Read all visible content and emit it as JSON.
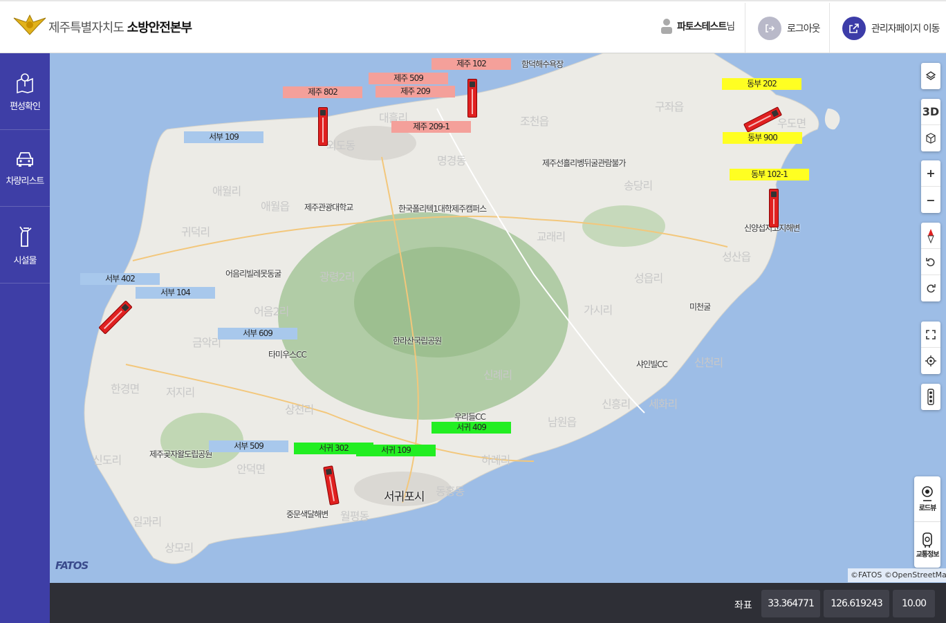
{
  "header": {
    "org_prefix": "제주특별자치도",
    "org_name": "소방안전본부",
    "user_name": "파토스테스트",
    "user_suffix": "님",
    "logout_label": "로그아웃",
    "admin_label": "관리자페이지 이동"
  },
  "sidebar": {
    "items": [
      {
        "label": "편성확인",
        "icon": "map-pin-icon"
      },
      {
        "label": "차량리스트",
        "icon": "car-icon"
      },
      {
        "label": "시설물",
        "icon": "hydrant-icon"
      }
    ]
  },
  "map": {
    "places": [
      "함덕해수욕장",
      "조천읍",
      "구좌읍",
      "우도면",
      "제주선흘리벵뒤굴관람불가",
      "송당리",
      "제주관광대학교",
      "한국폴리텍1대학제주캠퍼스",
      "애월리",
      "애월읍",
      "귀덕리",
      "교래리",
      "성산읍",
      "신양섭지코지해변",
      "미천굴",
      "어음리빌레못동굴",
      "광령2리",
      "어음2리",
      "성읍리",
      "가시리",
      "한라산국립공원",
      "금악리",
      "타미우스CC",
      "샤인빌CC",
      "신천리",
      "한경면",
      "저지리",
      "상천리",
      "신례리",
      "우리들CC",
      "남원읍",
      "신흥리",
      "세화리",
      "제주곶자왈도립공원",
      "안덕면",
      "하례리",
      "서귀포시",
      "동홍동",
      "중문색달해변",
      "월평동",
      "일과리",
      "상모리",
      "신도리",
      "대흘리",
      "명경동",
      "외도동"
    ],
    "vehicles": [
      {
        "label": "제주 102",
        "group": "jeju"
      },
      {
        "label": "제주 509",
        "group": "jeju"
      },
      {
        "label": "제주 802",
        "group": "jeju"
      },
      {
        "label": "제주 209",
        "group": "jeju"
      },
      {
        "label": "제주 209-1",
        "group": "jeju"
      },
      {
        "label": "서부 109",
        "group": "seobu"
      },
      {
        "label": "서부 402",
        "group": "seobu"
      },
      {
        "label": "서부 104",
        "group": "seobu"
      },
      {
        "label": "서부 609",
        "group": "seobu"
      },
      {
        "label": "서부 509",
        "group": "seobu"
      },
      {
        "label": "서귀 302",
        "group": "seogwi"
      },
      {
        "label": "서귀 109",
        "group": "seogwi"
      },
      {
        "label": "서귀 409",
        "group": "seogwi"
      },
      {
        "label": "동부 202",
        "group": "dongbu"
      },
      {
        "label": "동부 900",
        "group": "dongbu"
      },
      {
        "label": "동부 102-1",
        "group": "dongbu"
      }
    ],
    "group_colors": {
      "jeju": "#f4a09a",
      "seobu": "#a8c8ec",
      "seogwi": "#22ee22",
      "dongbu": "#ffff22"
    },
    "controls": {
      "three_d": "3D",
      "zoom_in": "+",
      "zoom_out": "−"
    },
    "tools": [
      {
        "label": "로드뷰",
        "icon": "roadview-icon"
      },
      {
        "label": "교통정보",
        "icon": "traffic-info-icon"
      }
    ],
    "attribution": "©FATOS ©OpenStreetMap",
    "brand": "FATOS"
  },
  "footer": {
    "coord_label": "좌표",
    "lat": "33.364771",
    "lng": "126.619243",
    "zoom": "10.00"
  }
}
